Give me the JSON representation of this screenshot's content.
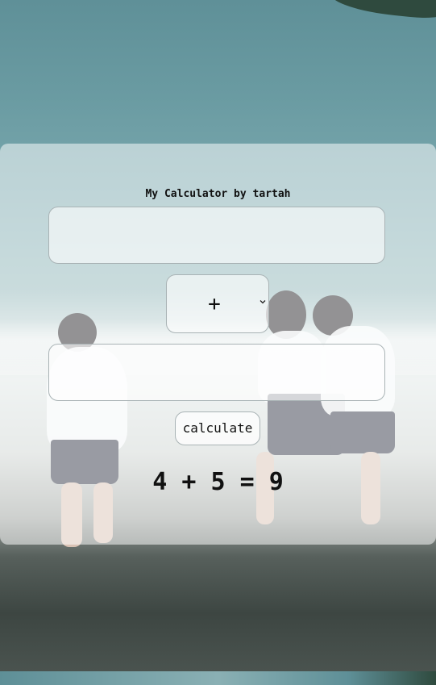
{
  "app": {
    "title": "My Calculator by tartah"
  },
  "form": {
    "first_number": {
      "value": "",
      "placeholder": ""
    },
    "operator": {
      "selected": "+"
    },
    "second_number": {
      "value": "",
      "placeholder": ""
    },
    "calculate_label": "calculate"
  },
  "result": {
    "text": "4 + 5 = 9"
  },
  "icons": {
    "select_arrow": "chevron-down-icon"
  }
}
